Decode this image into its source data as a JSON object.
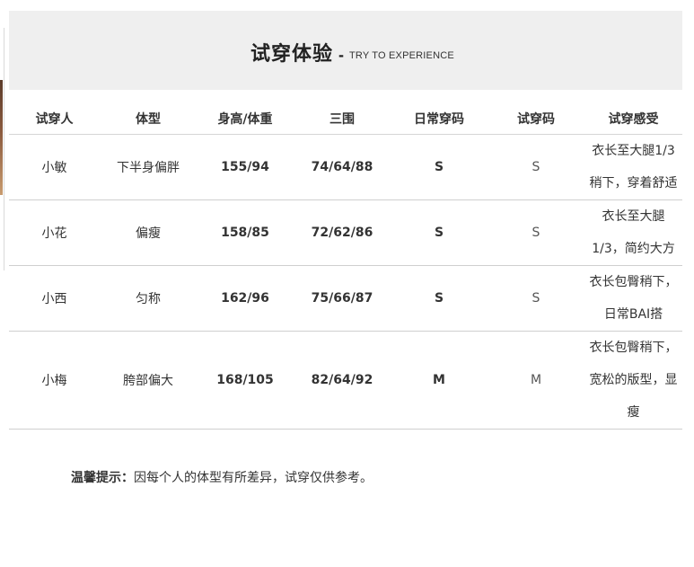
{
  "header": {
    "title_cn": "试穿体验",
    "dash": "-",
    "title_en": "TRY TO EXPERIENCE"
  },
  "table": {
    "columns": [
      "试穿人",
      "体型",
      "身高/体重",
      "三围",
      "日常穿码",
      "试穿码",
      "试穿感受"
    ],
    "rows": [
      {
        "name": "小敏",
        "body_type": "下半身偏胖",
        "height_weight": "155/94",
        "measurements": "74/64/88",
        "daily_size": "S",
        "trial_size": "S",
        "feeling_lines": [
          "衣长至大腿1/3",
          "稍下，穿着舒适"
        ]
      },
      {
        "name": "小花",
        "body_type": "偏瘦",
        "height_weight": "158/85",
        "measurements": "72/62/86",
        "daily_size": "S",
        "trial_size": "S",
        "feeling_lines": [
          "衣长至大腿",
          "1/3，简约大方"
        ]
      },
      {
        "name": "小西",
        "body_type": "匀称",
        "height_weight": "162/96",
        "measurements": "75/66/87",
        "daily_size": "S",
        "trial_size": "S",
        "feeling_lines": [
          "衣长包臀稍下，",
          "日常BAI搭"
        ]
      },
      {
        "name": "小梅",
        "body_type": "胯部偏大",
        "height_weight": "168/105",
        "measurements": "82/64/92",
        "daily_size": "M",
        "trial_size": "M",
        "feeling_lines": [
          "衣长包臀稍下，",
          "宽松的版型，显",
          "瘦"
        ]
      }
    ]
  },
  "tip": {
    "label": "温馨提示：",
    "text": "因每个人的体型有所差异，试穿仅供参考。"
  },
  "colors": {
    "header_band": "#efefef",
    "text": "#333333",
    "rule": "#cfcfcf"
  }
}
